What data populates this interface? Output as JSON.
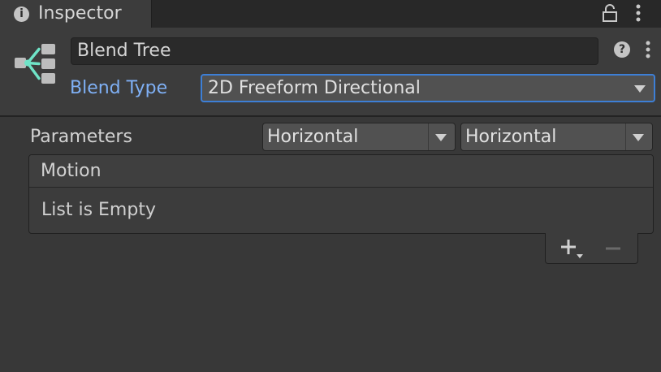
{
  "tab": {
    "title": "Inspector",
    "info_glyph": "i",
    "icon": "info-icon"
  },
  "header": {
    "name": "Blend Tree",
    "help_glyph": "?",
    "blend_type_label": "Blend Type",
    "blend_type_value": "2D Freeform Directional"
  },
  "parameters": {
    "label": "Parameters",
    "x_value": "Horizontal",
    "y_value": "Horizontal"
  },
  "motion_list": {
    "title": "Motion",
    "empty_text": "List is Empty"
  },
  "colors": {
    "accent": "#3d7fd6",
    "label_blue": "#7fb0f5",
    "icon_teal": "#6fe3c7"
  }
}
